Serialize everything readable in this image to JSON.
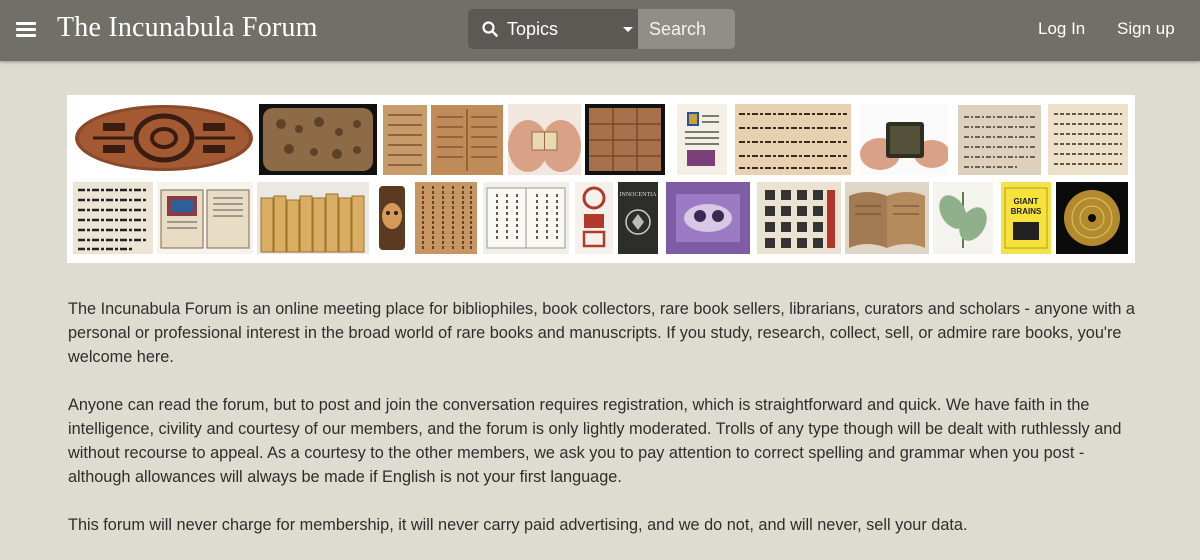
{
  "header": {
    "title": "The Incunabula Forum",
    "topics_label": "Topics",
    "search_placeholder": "Search",
    "login_label": "Log In",
    "signup_label": "Sign up"
  },
  "banner": {
    "images": [
      "clay-tablet-oval",
      "cuneiform-tablet",
      "papyrus-fragment",
      "clay-tablet-columns",
      "miniature-book-in-hands",
      "clay-tablet-grid",
      "illuminated-manuscript",
      "latin-manuscript-text",
      "miniature-book-in-fingers",
      "manuscript-page",
      "hebrew-manuscript",
      "early-printed-text",
      "open-illuminated-book",
      "row-of-vellum-books",
      "scroll-with-face",
      "chinese-woodblock-text",
      "asian-stitched-book",
      "chinese-seals",
      "printed-title-page",
      "purple-illustration",
      "chinese-characters-page",
      "worn-open-book",
      "botanical-leaf-print",
      "giant-brains-book",
      "golden-record"
    ]
  },
  "intro": {
    "paragraphs": [
      "The Incunabula Forum is an online meeting place for bibliophiles, book collectors, rare book sellers, librarians, curators and scholars - anyone with a personal or professional interest in the broad world of rare books and manuscripts. If you study, research, collect, sell, or admire rare books, you're welcome here.",
      "Anyone can read the forum, but to post and join the conversation requires registration, which is straightforward and quick. We have faith in the intelligence, civility and courtesy of our members, and the forum is only lightly moderated. Trolls of any type though will be dealt with ruthlessly and without recourse to appeal. As a courtesy to the other members, we ask you to pay attention to correct spelling and grammar when you post - although allowances will always be made if English is not your first language.",
      "This forum will never charge for membership, it will never carry paid advertising, and we do not, and will never, sell your data."
    ]
  },
  "colors": {
    "header_bg": "#706f68",
    "page_bg": "#dedbd0",
    "search_bg": "#8f8e87",
    "topics_bg": "#5a5953"
  }
}
